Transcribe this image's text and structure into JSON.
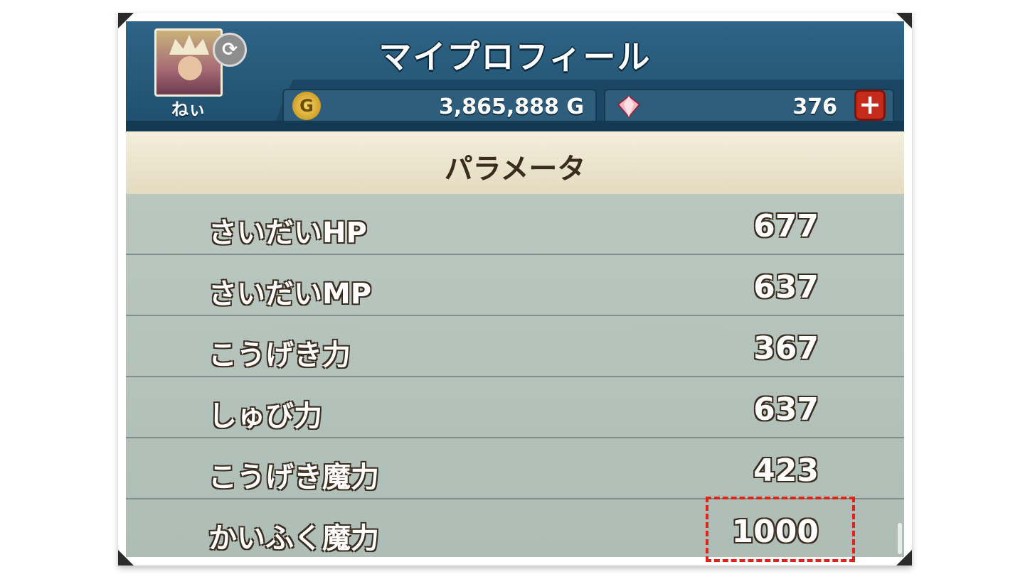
{
  "header": {
    "title": "マイプロフィール",
    "player_name": "ねぃ",
    "gold": "3,865,888 G",
    "gold_icon_glyph": "G",
    "gems": "376",
    "plus_label": "+"
  },
  "section": {
    "title": "パラメータ"
  },
  "params": [
    {
      "label": "さいだいHP",
      "value": "677"
    },
    {
      "label": "さいだいMP",
      "value": "637"
    },
    {
      "label": "こうげき力",
      "value": "367"
    },
    {
      "label": "しゅび力",
      "value": "637"
    },
    {
      "label": "こうげき魔力",
      "value": "423"
    },
    {
      "label": "かいふく魔力",
      "value": "1000"
    }
  ],
  "icons": {
    "refresh": "refresh-icon",
    "coin": "gold-coin-icon",
    "gem": "gem-icon",
    "plus": "plus-icon"
  },
  "colors": {
    "header_blue": "#2f6486",
    "highlight_red": "#e02418",
    "plus_red": "#c52a1a"
  }
}
